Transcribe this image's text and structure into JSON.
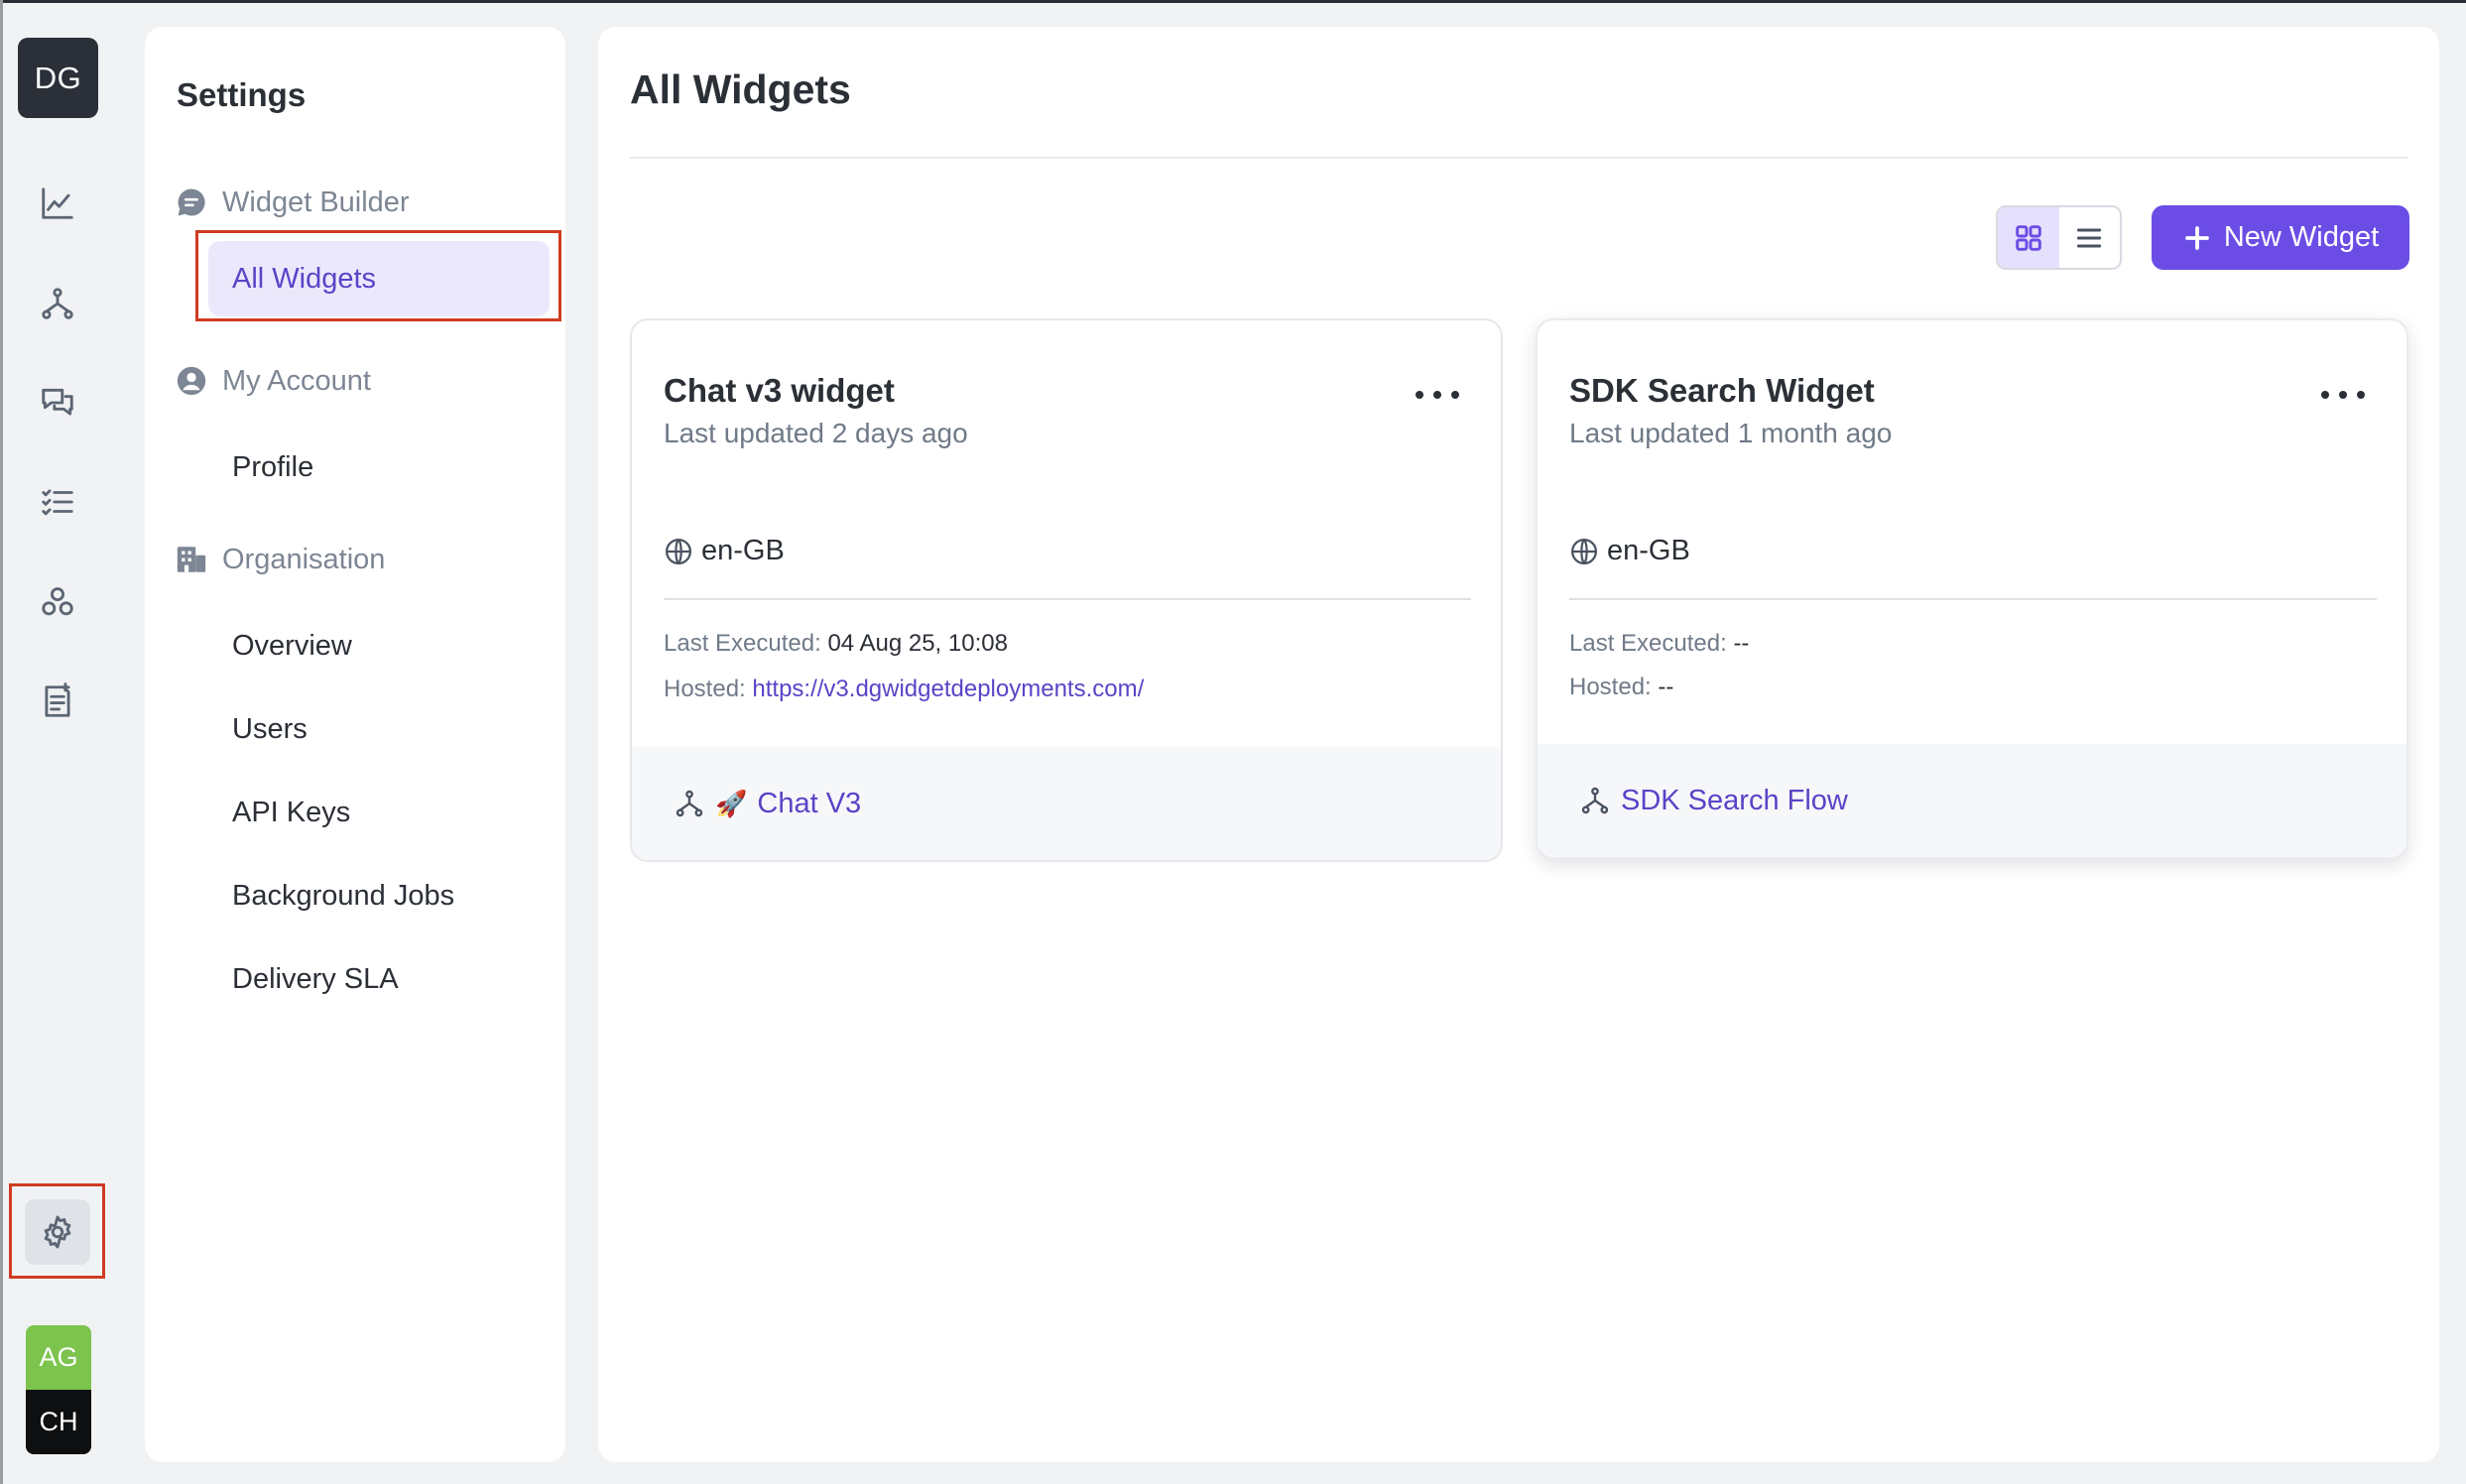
{
  "rail": {
    "brand": "DG",
    "icons": [
      "analytics-icon",
      "flows-icon",
      "conversations-icon",
      "tasks-icon",
      "integrations-icon",
      "knowledge-icon"
    ],
    "settings_icon": "gear-icon",
    "avatars": [
      "AG",
      "CH"
    ]
  },
  "settings": {
    "title": "Settings",
    "sections": [
      {
        "label": "Widget Builder",
        "items": [
          "All Widgets"
        ]
      },
      {
        "label": "My Account",
        "items": [
          "Profile"
        ]
      },
      {
        "label": "Organisation",
        "items": [
          "Overview",
          "Users",
          "API Keys",
          "Background Jobs",
          "Delivery SLA"
        ]
      }
    ],
    "active_item": "All Widgets"
  },
  "main": {
    "title": "All Widgets",
    "new_widget_label": "New Widget",
    "view_mode": "grid",
    "cards": [
      {
        "title": "Chat v3 widget",
        "updated": "Last updated 2 days ago",
        "lang": "en-GB",
        "last_executed_label": "Last Executed:",
        "last_executed": "04 Aug 25, 10:08",
        "hosted_label": "Hosted:",
        "hosted": "https://v3.dgwidgetdeployments.com/",
        "flow_emoji": "🚀",
        "flow": "Chat V3"
      },
      {
        "title": "SDK Search Widget",
        "updated": "Last updated 1 month ago",
        "lang": "en-GB",
        "last_executed_label": "Last Executed:",
        "last_executed": "--",
        "hosted_label": "Hosted:",
        "hosted": "--",
        "flow": "SDK Search Flow"
      }
    ]
  },
  "colors": {
    "accent": "#6b4de6",
    "accent_text": "#5b43c7",
    "highlight_box": "#cf3b22",
    "brand_bg": "#2a2f38"
  }
}
